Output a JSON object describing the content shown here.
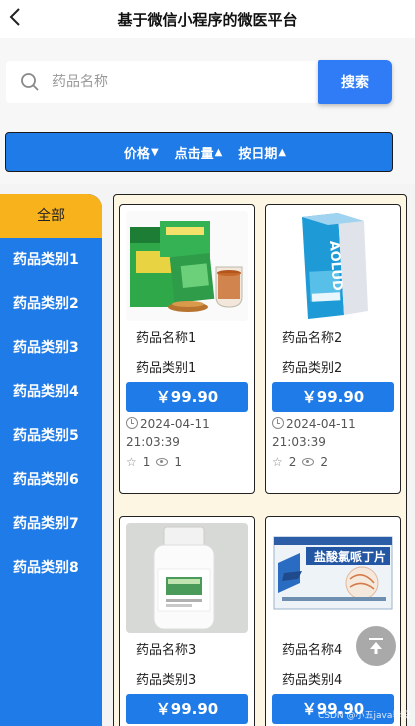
{
  "header": {
    "title": "基于微信小程序的微医平台",
    "back_icon": "chevron-left-icon"
  },
  "search": {
    "placeholder": "药品名称",
    "value": "",
    "button_label": "搜索"
  },
  "sort": {
    "items": [
      {
        "label": "价格",
        "direction": "down"
      },
      {
        "label": "点击量",
        "direction": "up"
      },
      {
        "label": "按日期",
        "direction": "up"
      }
    ]
  },
  "sidebar": {
    "items": [
      {
        "label": "全部",
        "active": true
      },
      {
        "label": "药品类别1"
      },
      {
        "label": "药品类别2"
      },
      {
        "label": "药品类别3"
      },
      {
        "label": "药品类别4"
      },
      {
        "label": "药品类别5"
      },
      {
        "label": "药品类别6"
      },
      {
        "label": "药品类别7"
      },
      {
        "label": "药品类别8"
      }
    ]
  },
  "products": [
    {
      "name": "药品名称1",
      "category": "药品类别1",
      "price": "￥99.90",
      "date": "2024-04-11",
      "time": "21:03:39",
      "likes": "1",
      "views": "1"
    },
    {
      "name": "药品名称2",
      "category": "药品类别2",
      "price": "￥99.90",
      "date": "2024-04-11",
      "time": "21:03:39",
      "likes": "2",
      "views": "2"
    },
    {
      "name": "药品名称3",
      "category": "药品类别3",
      "price": "￥99.90"
    },
    {
      "name": "药品名称4",
      "category": "药品类别4",
      "price": "￥99.90"
    }
  ],
  "product_images": {
    "image2_label": "AOLUD",
    "image4_label": "盐酸氯哌丁片"
  },
  "watermark": "CSDN @小五java毕设",
  "colors": {
    "primary": "#1f7be8",
    "active": "#f7b21c",
    "search_button": "#2f7cf6"
  }
}
